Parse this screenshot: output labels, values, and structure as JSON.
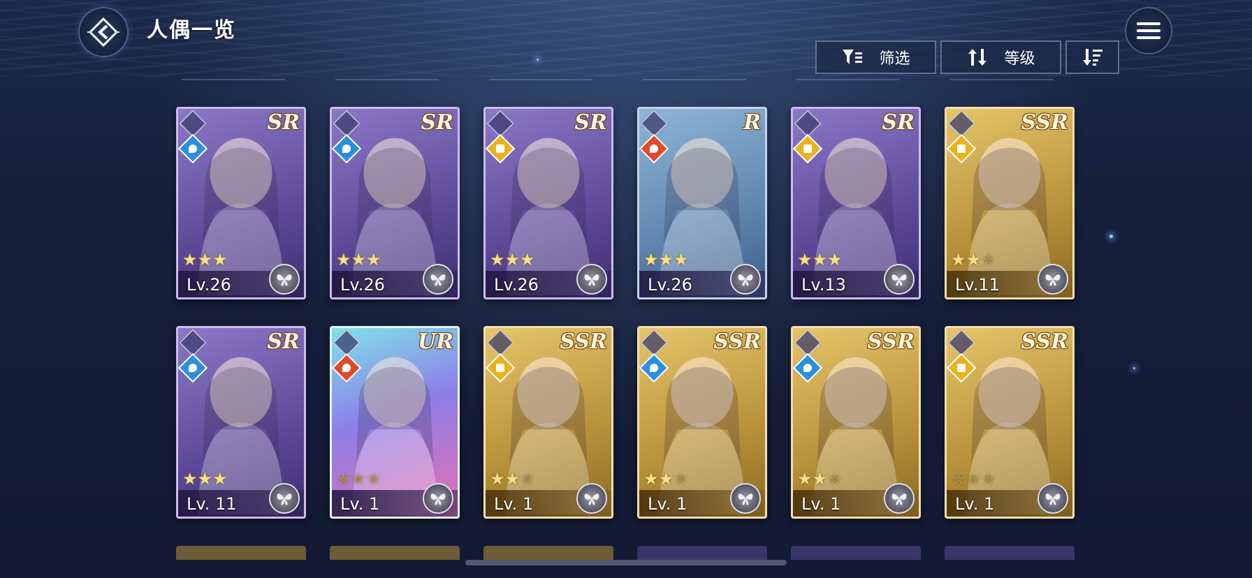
{
  "header": {
    "title": "人偶一览"
  },
  "toolbar": {
    "filter_label": "筛选",
    "sort_label": "等级"
  },
  "cards": [
    {
      "rarity": "SR",
      "element": "water",
      "stars": 3,
      "max_stars": 3,
      "level": "Lv.26"
    },
    {
      "rarity": "SR",
      "element": "water",
      "stars": 3,
      "max_stars": 3,
      "level": "Lv.26"
    },
    {
      "rarity": "SR",
      "element": "light",
      "stars": 3,
      "max_stars": 3,
      "level": "Lv.26"
    },
    {
      "rarity": "R",
      "element": "fire",
      "stars": 3,
      "max_stars": 3,
      "level": "Lv.26"
    },
    {
      "rarity": "SR",
      "element": "light",
      "stars": 3,
      "max_stars": 3,
      "level": "Lv.13"
    },
    {
      "rarity": "SSR",
      "element": "light",
      "stars": 2,
      "max_stars": 3,
      "level": "Lv.11"
    },
    {
      "rarity": "SR",
      "element": "water",
      "stars": 3,
      "max_stars": 3,
      "level": "Lv. 11"
    },
    {
      "rarity": "UR",
      "element": "fire",
      "stars": 0,
      "max_stars": 3,
      "level": "Lv. 1"
    },
    {
      "rarity": "SSR",
      "element": "light",
      "stars": 2,
      "max_stars": 3,
      "level": "Lv. 1"
    },
    {
      "rarity": "SSR",
      "element": "water",
      "stars": 2,
      "max_stars": 3,
      "level": "Lv. 1"
    },
    {
      "rarity": "SSR",
      "element": "water",
      "stars": 2,
      "max_stars": 3,
      "level": "Lv. 1"
    },
    {
      "rarity": "SSR",
      "element": "light",
      "stars": 0,
      "max_stars": 3,
      "level": "Lv. 1"
    }
  ],
  "next_row_rarities": [
    "SSR",
    "SSR",
    "SSR",
    "SR",
    "SR",
    "SR"
  ],
  "colors": {
    "background": "#15203c",
    "sr_frame": "#5d4a98",
    "ssr_frame": "#b8913a",
    "r_frame": "#5f86b0",
    "star": "#f6e08a"
  },
  "icons": {
    "back": "back-arrow-icon",
    "menu": "hamburger-menu-icon",
    "filter": "filter-icon",
    "sort": "sort-toggle-icon",
    "order": "sort-order-icon",
    "emblem": "butterfly-emblem-icon"
  }
}
